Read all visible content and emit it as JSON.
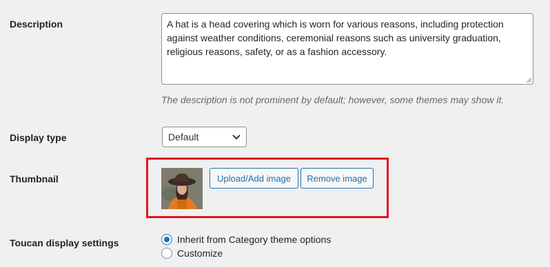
{
  "fields": {
    "description_label": "Description",
    "description_value": "A hat is a head covering which is worn for various reasons, including protection against weather conditions, ceremonial reasons such as university graduation, religious reasons, safety, or as a fashion accessory.",
    "description_hint": "The description is not prominent by default; however, some themes may show it.",
    "display_type_label": "Display type",
    "display_type_value": "Default",
    "thumbnail_label": "Thumbnail",
    "upload_button": "Upload/Add image",
    "remove_button": "Remove image",
    "toucan_label": "Toucan display settings",
    "radio_options": [
      {
        "label": "Inherit from Category theme options",
        "checked": true
      },
      {
        "label": "Customize",
        "checked": false
      }
    ]
  },
  "colors": {
    "accent": "#2271b1",
    "highlight_border": "#e0141e",
    "background": "#f0f0f1"
  }
}
